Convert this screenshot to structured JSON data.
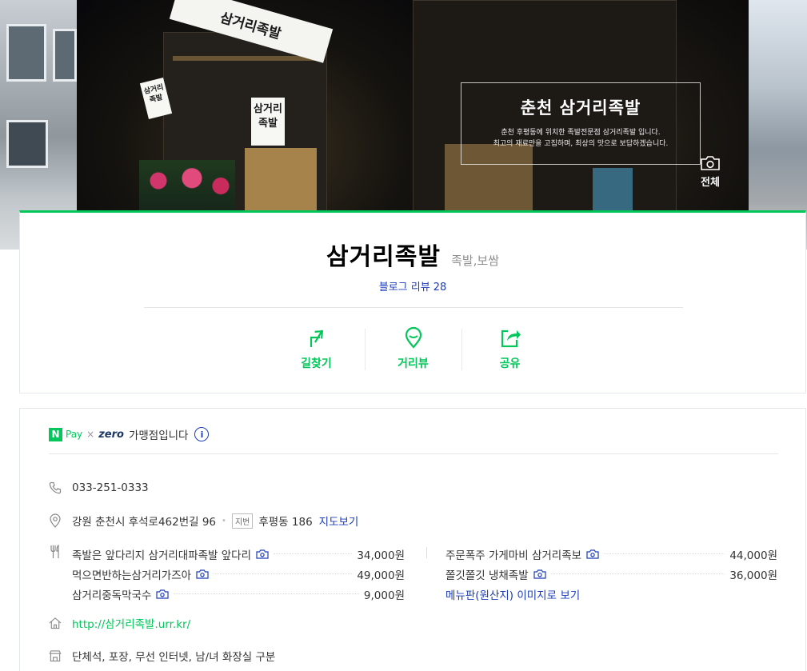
{
  "hero": {
    "sign_text": "삼거리족발",
    "overlay_title": "춘천 삼거리족발",
    "overlay_desc_1": "춘천 후평동에 위치한 족발전문점 삼거리족발 입니다.",
    "overlay_desc_2": "최고의 재료만을 고집하며, 최상의 맛으로 보답하겠습니다.",
    "all_photos_label": "전체"
  },
  "summary": {
    "name": "삼거리족발",
    "category": "족발,보쌈",
    "blog_review_label": "블로그 리뷰",
    "blog_review_count": "28",
    "actions": {
      "directions": "길찾기",
      "distance_view": "거리뷰",
      "share": "공유"
    }
  },
  "info": {
    "npay": {
      "n": "N",
      "pay": "Pay",
      "times": "×",
      "zero": "zero",
      "text": "가맹점입니다",
      "info_icon": "i"
    },
    "phone": "033-251-0333",
    "address": {
      "road": "강원 춘천시 후석로462번길 96",
      "dot": "•",
      "jibun_tag": "지번",
      "jibun": "후평동 186",
      "map_link": "지도보기"
    },
    "menu_left": [
      {
        "name": "족발은 앞다리지 삼거리대파족발 앞다리",
        "price": "34,000원"
      },
      {
        "name": "먹으면반하는삼거리가즈아",
        "price": "49,000원"
      },
      {
        "name": "삼거리중독막국수",
        "price": "9,000원"
      }
    ],
    "menu_right": [
      {
        "name": "주문폭주 가게마비 삼거리족보",
        "price": "44,000원"
      },
      {
        "name": "쫄깃쫄깃 냉채족발",
        "price": "36,000원"
      }
    ],
    "menu_board_link": "메뉴판(원산지) 이미지로 보기",
    "homepage": "http://삼거리족발.urr.kr/",
    "facilities": "단체석, 포장, 무선 인터넷, 남/녀 화장실 구분"
  },
  "colors": {
    "accent_green": "#03c75a",
    "link_blue": "#1c3cb9"
  },
  "icons": [
    "camera-icon",
    "directions-icon",
    "location-pin-icon",
    "share-icon",
    "info-icon",
    "phone-icon",
    "map-pin-icon",
    "fork-icon",
    "home-icon",
    "store-icon"
  ]
}
